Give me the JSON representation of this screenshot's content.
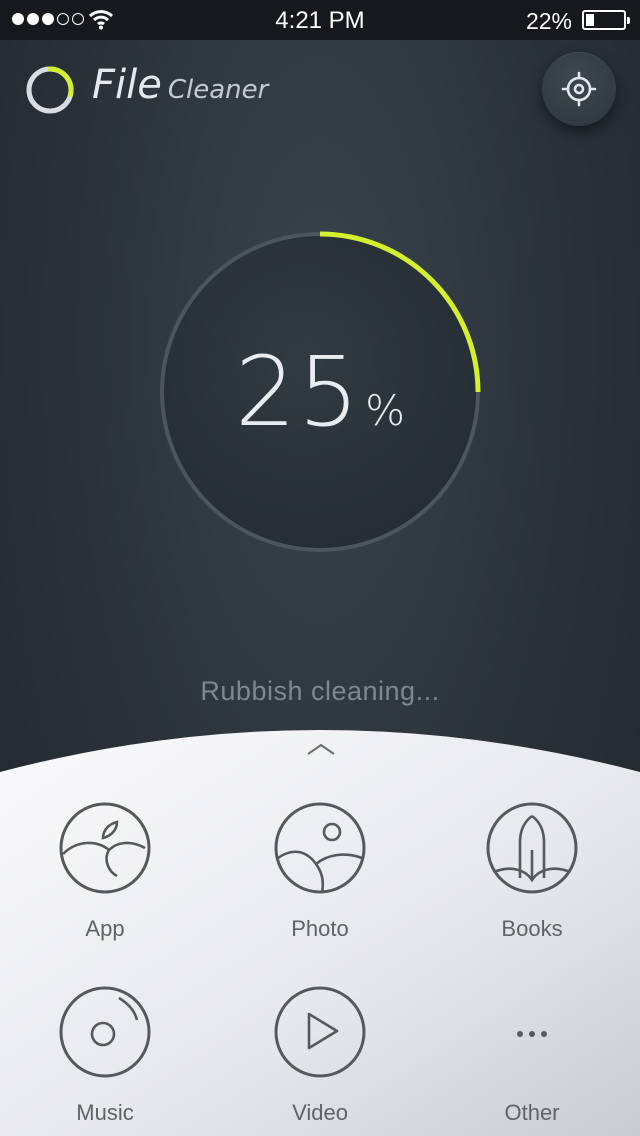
{
  "status_bar": {
    "time": "4:21 PM",
    "battery_percent": "22%",
    "battery_level": 0.22,
    "signal_bars_filled": 3,
    "signal_bars_total": 5
  },
  "header": {
    "title": "File",
    "subtitle": "Cleaner",
    "logo_icon": "ring-logo-icon",
    "settings_icon": "gear-icon"
  },
  "progress": {
    "value": "25",
    "unit": "%",
    "fraction": 0.25,
    "accent_color": "#d4ef2c",
    "track_color": "#4a535c"
  },
  "status_text": "Rubbish cleaning...",
  "panel": {
    "expand_icon": "chevron-up-icon",
    "categories": [
      {
        "label": "App",
        "icon": "apple-icon"
      },
      {
        "label": "Photo",
        "icon": "photo-icon"
      },
      {
        "label": "Books",
        "icon": "book-icon"
      },
      {
        "label": "Music",
        "icon": "disc-icon"
      },
      {
        "label": "Video",
        "icon": "play-icon"
      },
      {
        "label": "Other",
        "icon": "more-icon"
      }
    ]
  }
}
